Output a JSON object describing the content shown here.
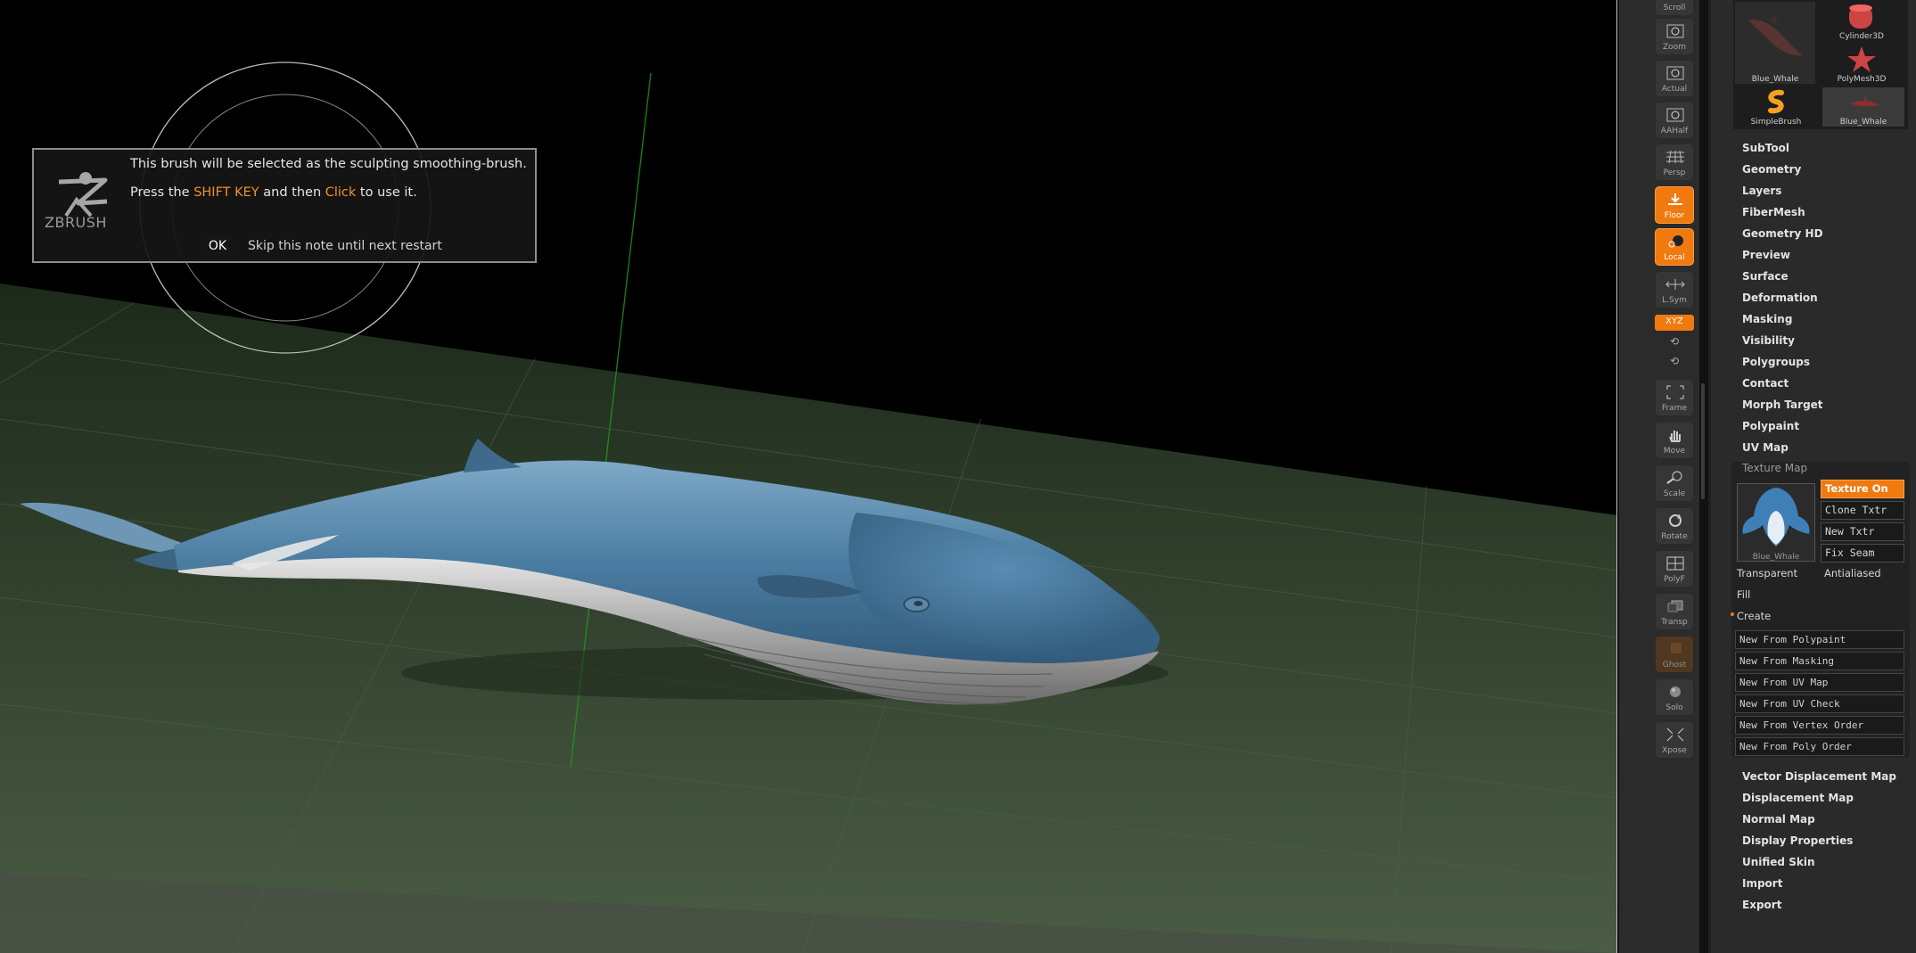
{
  "dialog": {
    "line1": "This brush will be selected as the sculpting smoothing-brush.",
    "line2_a": "Press the ",
    "line2_shift": "SHIFT KEY",
    "line2_b": " and then ",
    "line2_click": "Click",
    "line2_c": " to use it.",
    "ok": "OK",
    "skip": "Skip this note until next restart",
    "logo_text": "ZBRUSH"
  },
  "shelf": {
    "top_partial": "Scroll",
    "buttons": {
      "zoom": "Zoom",
      "actual": "Actual",
      "aahalf": "AAHalf",
      "persp": "Persp",
      "floor": "Floor",
      "local": "Local",
      "lsym": "L.Sym",
      "xyz": "XYZ",
      "frame": "Frame",
      "move": "Move",
      "scale": "Scale",
      "rotate": "Rotate",
      "polyf": "PolyF",
      "transp": "Transp",
      "ghost": "Ghost",
      "solo": "Solo",
      "xpose": "Xpose"
    }
  },
  "palette": {
    "thumbs": {
      "blue_whale_1": "Blue_Whale",
      "cylinder": "Cylinder3D",
      "polymesh": "PolyMesh3D",
      "simplebrush": "SimpleBrush",
      "blue_whale_2": "Blue_Whale"
    },
    "menu_top": [
      "SubTool",
      "Geometry",
      "Layers",
      "FiberMesh",
      "Geometry HD",
      "Preview",
      "Surface",
      "Deformation",
      "Masking",
      "Visibility",
      "Polygroups",
      "Contact",
      "Morph Target",
      "Polypaint",
      "UV Map"
    ],
    "texture_map": {
      "header": "Texture Map",
      "preview_label": "Blue_Whale",
      "texture_on": "Texture On",
      "clone_txtr": "Clone Txtr",
      "new_txtr": "New Txtr",
      "fix_seam": "Fix Seam",
      "transparent": "Transparent",
      "antialiased": "Antialiased",
      "fill": "Fill",
      "create": "Create",
      "create_items": [
        "New From Polypaint",
        "New From Masking",
        "New From UV Map",
        "New From UV Check",
        "New From Vertex Order",
        "New From Poly Order"
      ]
    },
    "menu_bottom": [
      "Vector Displacement Map",
      "Displacement Map",
      "Normal Map",
      "Display Properties",
      "Unified Skin",
      "Import",
      "Export"
    ]
  },
  "colors": {
    "accent": "#f07a10",
    "highlight_text": "#f0922a",
    "floor": "#3b4a36",
    "whale_top": "#4f7fa3",
    "whale_belly": "#c9c9c9"
  }
}
